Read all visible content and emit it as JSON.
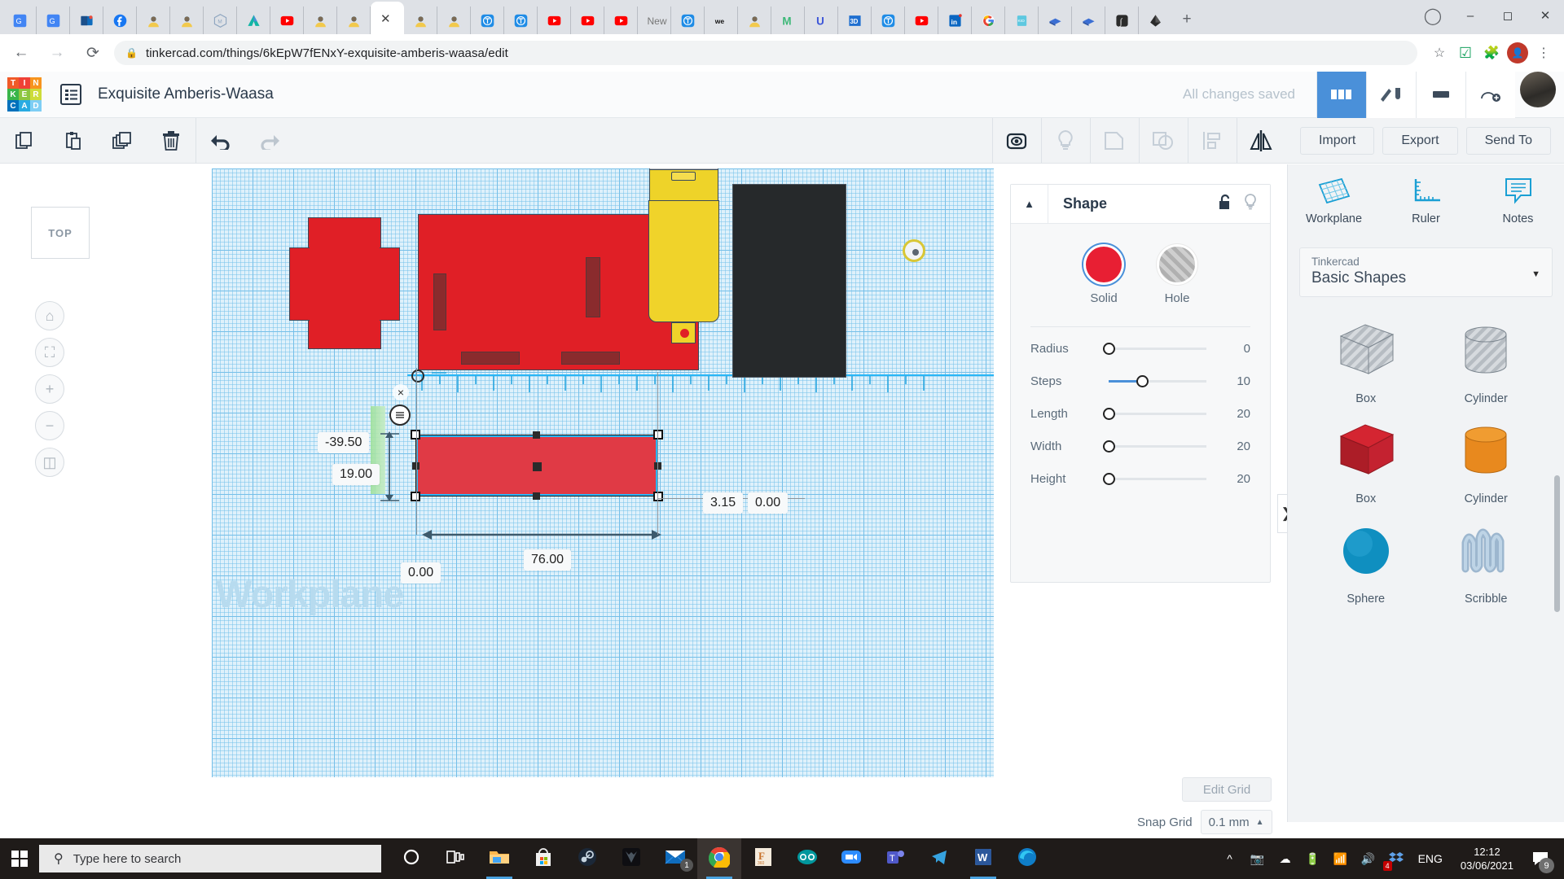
{
  "browser": {
    "tabs": [
      {
        "icon": "google-translate-icon",
        "active": false
      },
      {
        "icon": "google-translate-icon",
        "active": false
      },
      {
        "icon": "outlook-icon",
        "active": false
      },
      {
        "icon": "facebook-icon",
        "active": false
      },
      {
        "icon": "avatar-icon",
        "active": false
      },
      {
        "icon": "avatar-icon",
        "active": false
      },
      {
        "icon": "hexagon-m-icon",
        "active": false
      },
      {
        "icon": "autodesk-icon",
        "active": false
      },
      {
        "icon": "youtube-icon",
        "active": false
      },
      {
        "icon": "avatar-icon",
        "active": false
      },
      {
        "icon": "avatar-icon",
        "active": false
      },
      {
        "icon": "close-icon",
        "active": true
      },
      {
        "icon": "avatar-icon",
        "active": false
      },
      {
        "icon": "avatar-icon",
        "active": false
      },
      {
        "icon": "tinkercad-icon",
        "active": false
      },
      {
        "icon": "tinkercad-icon",
        "active": false
      },
      {
        "icon": "youtube-icon",
        "active": false
      },
      {
        "icon": "youtube-icon",
        "active": false
      },
      {
        "icon": "youtube-icon",
        "active": false
      },
      {
        "icon": "new-tab-text-icon",
        "label": "New",
        "active": false
      },
      {
        "icon": "tinkercad-icon",
        "active": false
      },
      {
        "icon": "we-icon",
        "active": false
      },
      {
        "icon": "avatar-icon",
        "active": false
      },
      {
        "icon": "medium-m-icon",
        "active": false
      },
      {
        "icon": "udemy-u-icon",
        "active": false
      },
      {
        "icon": "3d-icon",
        "active": false
      },
      {
        "icon": "tinkercad-icon",
        "active": false
      },
      {
        "icon": "youtube-icon",
        "active": false
      },
      {
        "icon": "linkedin-icon",
        "active": false
      },
      {
        "icon": "google-icon",
        "active": false
      },
      {
        "icon": "kidbright-icon",
        "active": false
      },
      {
        "icon": "blue-book-icon",
        "active": false
      },
      {
        "icon": "blue-book-icon",
        "active": false
      },
      {
        "icon": "integral-icon",
        "active": false
      },
      {
        "icon": "inkscape-icon",
        "active": false
      }
    ],
    "new_tab_label": "+",
    "window_controls": [
      "record-dot",
      "minimize",
      "maximize",
      "close"
    ],
    "back_label": "←",
    "forward_label": "→",
    "reload_label": "⟳",
    "url": "tinkercad.com/things/6kEpW7fENxY-exquisite-amberis-waasa/edit",
    "lock_icon": "lock-icon",
    "toolbar_icons": [
      "star-icon",
      "extension-check-icon",
      "puzzle-icon",
      "profile-avatar",
      "menu-kebab-icon"
    ]
  },
  "tinkercad": {
    "logo_letters": [
      "T",
      "I",
      "N",
      "K",
      "E",
      "R",
      "C",
      "A",
      "D"
    ],
    "logo_colors": [
      "#f05a28",
      "#ef4136",
      "#f7941e",
      "#39b54a",
      "#8dc63f",
      "#cddc39",
      "#0071bc",
      "#29abe2",
      "#7ecef4"
    ],
    "project_title": "Exquisite Amberis-Waasa",
    "save_status": "All changes saved",
    "header_icons": [
      "grid-view-icon",
      "codeblocks-icon",
      "blocks-icon",
      "add-person-icon",
      "user-avatar"
    ],
    "actionbar": {
      "icons": [
        "copy-icon",
        "paste-icon",
        "duplicate-icon",
        "delete-icon",
        "undo-icon",
        "redo-icon"
      ],
      "right_icons": [
        "show-hide-icon",
        "light-icon",
        "group-icon",
        "ungroup-icon",
        "align-icon",
        "mirror-icon"
      ]
    },
    "buttons": {
      "import": "Import",
      "export": "Export",
      "send_to": "Send To"
    },
    "view": {
      "cube_label": "TOP",
      "tools": [
        "home-view-icon",
        "fit-to-view-icon",
        "zoom-in-icon",
        "zoom-out-icon",
        "ortho-perspective-icon"
      ]
    },
    "canvas": {
      "workplane_label": "Workplane",
      "dimensions": {
        "y_offset": "-39.50",
        "height": "19.00",
        "length": "76.00",
        "x_offset": "0.00",
        "right_value": "3.15",
        "right_value_2": "0.00"
      },
      "close_handle": "×",
      "rotate_handle": "rotate-icon"
    },
    "shape_panel": {
      "title": "Shape",
      "collapse_icon": "chevron-up-icon",
      "lock_icon": "unlock-icon",
      "bulb_icon": "lightbulb-icon",
      "solid_label": "Solid",
      "hole_label": "Hole",
      "solid_color": "#e81f33",
      "selected_mode": "Solid",
      "properties": [
        {
          "name": "Radius",
          "value": "0",
          "fill_pct": 0
        },
        {
          "name": "Steps",
          "value": "10",
          "fill_pct": 34
        },
        {
          "name": "Length",
          "value": "20",
          "fill_pct": 0
        },
        {
          "name": "Width",
          "value": "20",
          "fill_pct": 0
        },
        {
          "name": "Height",
          "value": "20",
          "fill_pct": 0
        }
      ]
    },
    "sidebar": {
      "tools": [
        {
          "label": "Workplane",
          "icon": "workplane-icon"
        },
        {
          "label": "Ruler",
          "icon": "ruler-icon"
        },
        {
          "label": "Notes",
          "icon": "notes-icon"
        }
      ],
      "library_sup": "Tinkercad",
      "library_main": "Basic Shapes",
      "caret_icon": "chevron-down-icon",
      "shapes": [
        {
          "name": "Box",
          "kind": "box-hole"
        },
        {
          "name": "Cylinder",
          "kind": "cylinder-hole"
        },
        {
          "name": "Box",
          "kind": "box-red"
        },
        {
          "name": "Cylinder",
          "kind": "cylinder-orange"
        },
        {
          "name": "Sphere",
          "kind": "sphere-blue"
        },
        {
          "name": "Scribble",
          "kind": "scribble"
        }
      ],
      "expander_icon": "chevron-right-icon"
    },
    "bottom": {
      "edit_grid": "Edit Grid",
      "snap_grid_label": "Snap Grid",
      "snap_grid_value": "0.1 mm",
      "snap_caret": "▲"
    }
  },
  "taskbar": {
    "start_icon": "windows-start-icon",
    "search_placeholder": "Type here to search",
    "search_icon": "search-icon",
    "apps": [
      {
        "icon": "cortana-icon",
        "state": "idle"
      },
      {
        "icon": "task-view-icon",
        "state": "idle"
      },
      {
        "icon": "file-explorer-icon",
        "state": "running"
      },
      {
        "icon": "microsoft-store-icon",
        "state": "idle"
      },
      {
        "icon": "steam-icon",
        "state": "idle"
      },
      {
        "icon": "predator-icon",
        "state": "idle"
      },
      {
        "icon": "mail-icon",
        "state": "idle",
        "badge": "1"
      },
      {
        "icon": "chrome-icon",
        "state": "active"
      },
      {
        "icon": "fusion360-icon",
        "state": "idle"
      },
      {
        "icon": "arduino-icon",
        "state": "idle"
      },
      {
        "icon": "zoom-icon",
        "state": "idle"
      },
      {
        "icon": "teams-icon",
        "state": "idle"
      },
      {
        "icon": "telegram-icon",
        "state": "idle"
      },
      {
        "icon": "word-icon",
        "state": "running"
      },
      {
        "icon": "edge-icon",
        "state": "idle"
      }
    ],
    "tray": [
      "show-hidden-icons",
      "camera-icon",
      "onedrive-icon",
      "battery-icon",
      "wifi-icon",
      "volume-icon",
      "dropbox-icon"
    ],
    "dropbox_badge": "4",
    "language": "ENG",
    "time": "12:12",
    "date": "03/06/2021",
    "notification_icon": "notification-icon",
    "notification_count": "9"
  }
}
